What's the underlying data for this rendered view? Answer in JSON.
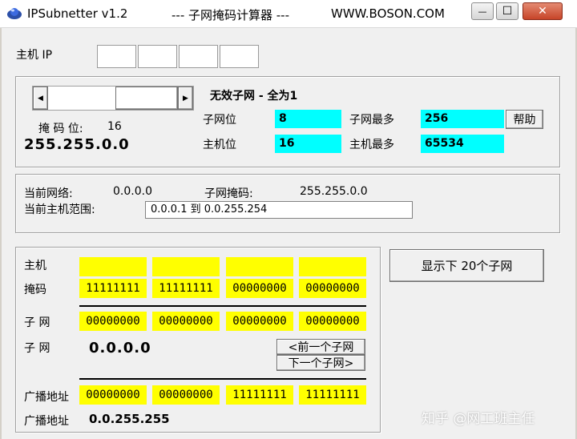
{
  "window": {
    "app_title": "IPSubnetter v1.2",
    "mid_title": "--- 子网掩码计算器 ---",
    "url_title": "WWW.BOSON.COM",
    "minimize_glyph": "—",
    "maximize_glyph": "☐",
    "close_glyph": "✕"
  },
  "host_ip": {
    "label": "主机 IP",
    "octets": [
      "",
      "",
      "",
      ""
    ]
  },
  "mask_panel": {
    "slider_left_glyph": "◀",
    "slider_right_glyph": "▶",
    "mask_bits_label": "掩 码 位:",
    "mask_bits_value": "16",
    "mask_value": "255.255.0.0",
    "warning": "无效子网 - 全为1",
    "subnet_bits_label": "子网位",
    "subnet_bits_value": "8",
    "host_bits_label": "主机位",
    "host_bits_value": "16",
    "max_subnets_label": "子网最多",
    "max_subnets_value": "256",
    "max_hosts_label": "主机最多",
    "max_hosts_value": "65534",
    "help_button": "帮助"
  },
  "current": {
    "network_label": "当前网络:",
    "network_value": "0.0.0.0",
    "subnet_mask_label": "子网掩码:",
    "subnet_mask_value": "255.255.0.0",
    "host_range_label": "当前主机范围:",
    "host_range_value": "0.0.0.1  到  0.0.255.254"
  },
  "binary": {
    "host_label": "主机",
    "host": [
      "",
      "",
      "",
      ""
    ],
    "mask_label": "掩码",
    "mask": [
      "11111111",
      "11111111",
      "00000000",
      "00000000"
    ],
    "subnet_label": "子 网",
    "subnet": [
      "00000000",
      "00000000",
      "00000000",
      "00000000"
    ],
    "subnet2_label": "子 网",
    "subnet_value": "0.0.0.0",
    "prev_button": "<前一个子网",
    "next_button": "下一个子网>",
    "broadcast_label": "广播地址",
    "broadcast": [
      "00000000",
      "00000000",
      "11111111",
      "11111111"
    ],
    "broadcast2_label": "广播地址",
    "broadcast_value": "0.0.255.255"
  },
  "show_next_button": "显示下 20个子网",
  "watermark": "知乎 @网工班主任",
  "colors": {
    "cyan": "#00ffff",
    "yellow": "#ffff00"
  }
}
